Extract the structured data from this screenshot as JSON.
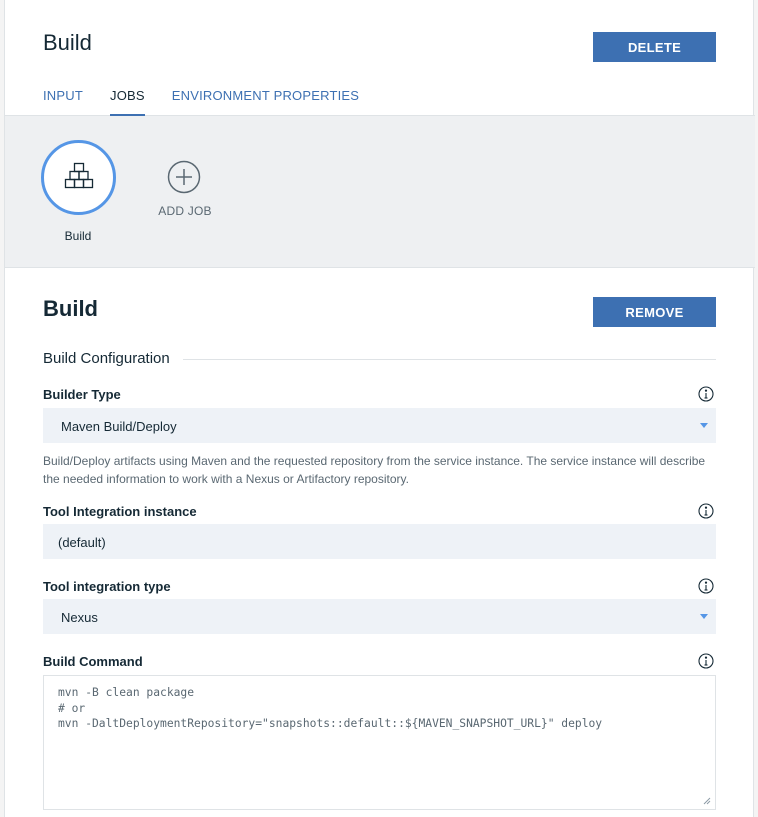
{
  "header": {
    "title": "Build",
    "delete_label": "DELETE",
    "tabs": [
      {
        "label": "INPUT",
        "active": false
      },
      {
        "label": "JOBS",
        "active": true
      },
      {
        "label": "ENVIRONMENT PROPERTIES",
        "active": false
      }
    ]
  },
  "jobs": {
    "items": [
      {
        "label": "Build",
        "icon": "stacked-boxes-icon"
      }
    ],
    "add_label": "ADD JOB",
    "add_icon": "plus-circle-icon"
  },
  "job_detail": {
    "title": "Build",
    "remove_label": "REMOVE",
    "config_heading": "Build Configuration",
    "builder_type": {
      "label": "Builder Type",
      "value": "Maven Build/Deploy",
      "helper": "Build/Deploy artifacts using Maven and the requested repository from the service instance. The service instance will describe the needed information to work with a Nexus or Artifactory repository."
    },
    "tool_instance": {
      "label": "Tool Integration instance",
      "value": "(default)"
    },
    "tool_type": {
      "label": "Tool integration type",
      "value": "Nexus"
    },
    "build_command": {
      "label": "Build Command",
      "value": "mvn -B clean package\n# or\nmvn -DaltDeploymentRepository=\"snapshots::default::${MAVEN_SNAPSHOT_URL}\" deploy"
    }
  },
  "colors": {
    "accent": "#3d70b2",
    "ring": "#5596e6",
    "jobs_background": "#eef0f2",
    "field_background": "#eef2f7"
  }
}
